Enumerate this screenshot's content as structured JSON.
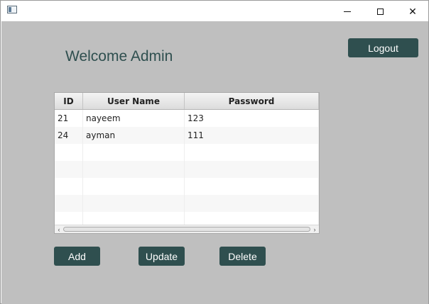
{
  "window": {
    "minimize_glyph": "",
    "close_glyph": "✕"
  },
  "header": {
    "welcome": "Welcome Admin",
    "logout_label": "Logout"
  },
  "table": {
    "columns": [
      "ID",
      "User Name",
      "Password"
    ],
    "rows": [
      {
        "id": "21",
        "username": "nayeem",
        "password": "123"
      },
      {
        "id": "24",
        "username": "ayman",
        "password": "111"
      },
      {
        "id": "",
        "username": "",
        "password": ""
      },
      {
        "id": "",
        "username": "",
        "password": ""
      },
      {
        "id": "",
        "username": "",
        "password": ""
      },
      {
        "id": "",
        "username": "",
        "password": ""
      },
      {
        "id": "",
        "username": "",
        "password": ""
      }
    ]
  },
  "actions": {
    "add_label": "Add",
    "update_label": "Update",
    "delete_label": "Delete"
  },
  "colors": {
    "accent": "#2f4f4f",
    "background": "#bfbfbf"
  }
}
